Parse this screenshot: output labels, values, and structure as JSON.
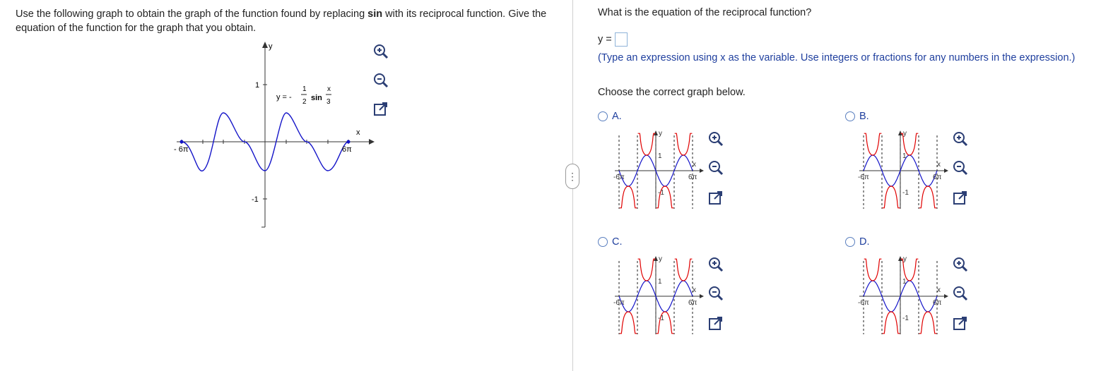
{
  "left": {
    "prompt_part1": "Use the following graph to obtain the graph of the function found by replacing ",
    "prompt_bold": "sin",
    "prompt_part2": " with its reciprocal function.  Give the equation of the function for the graph that you obtain.",
    "graph": {
      "y_label": "y",
      "x_label": "x",
      "tick_neg": "- 6π",
      "tick_pos": "6π",
      "ytick_pos": "1",
      "ytick_neg": "-1",
      "eq_prefix": "y = -",
      "eq_num": "1",
      "eq_den": "2",
      "eq_fn": "sin",
      "eq_arg_num": "x",
      "eq_arg_den": "3"
    }
  },
  "right": {
    "question": "What is the equation of the reciprocal function?",
    "answer_prefix": "y =",
    "answer_value": "",
    "hint": "(Type an expression using x as the variable.  Use integers or fractions for any numbers in the expression.)",
    "choose": "Choose the correct graph below.",
    "options": [
      {
        "label": "A.",
        "variant": "a"
      },
      {
        "label": "B.",
        "variant": "b"
      },
      {
        "label": "C.",
        "variant": "c"
      },
      {
        "label": "D.",
        "variant": "d"
      }
    ],
    "mini_graph": {
      "y_label": "y",
      "x_label": "x",
      "tick_neg": "-6π",
      "tick_pos": "6π",
      "ytick_pos": "1",
      "ytick_neg": "-1"
    }
  },
  "colors": {
    "sine": "#1414c8",
    "reciprocal": "#e00000",
    "asymptote": "#222222",
    "hint": "#1f3f9e"
  },
  "icons": [
    "zoom-in-icon",
    "zoom-out-icon",
    "expand-icon"
  ]
}
